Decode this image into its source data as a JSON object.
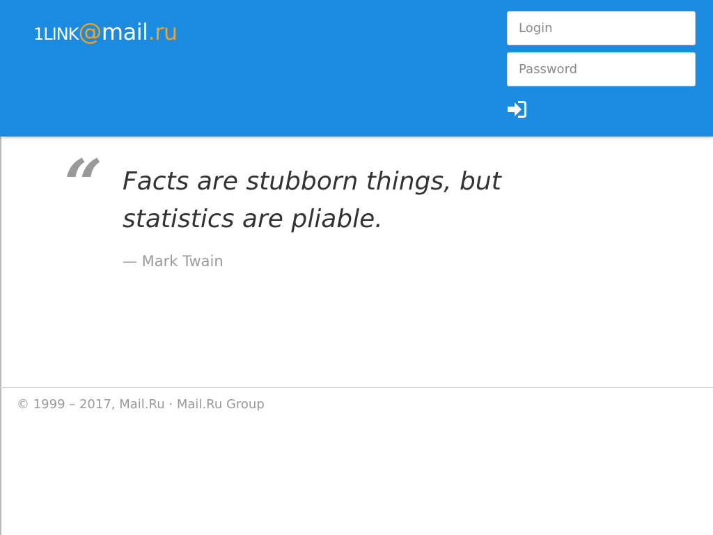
{
  "header": {
    "logo": {
      "prefix": "1LINK",
      "at": "@",
      "brand": "mail",
      "dot": ".",
      "tld": "ru"
    },
    "login": {
      "placeholder": "Login",
      "value": ""
    },
    "password": {
      "placeholder": "Password",
      "value": ""
    },
    "signin_icon": "sign-in-icon"
  },
  "quote": {
    "mark": "“",
    "text": "Facts are stubborn things, but statistics are pliable.",
    "author": "— Mark Twain"
  },
  "footer": {
    "copyright": "© 1999 – 2017,",
    "link_mailru": "Mail.Ru",
    "separator": "·",
    "link_group": "Mail.Ru Group"
  },
  "colors": {
    "header_bg": "#1a8be0",
    "logo_accent": "#ff9e1b",
    "muted_text": "#999999",
    "body_text": "#333333"
  }
}
